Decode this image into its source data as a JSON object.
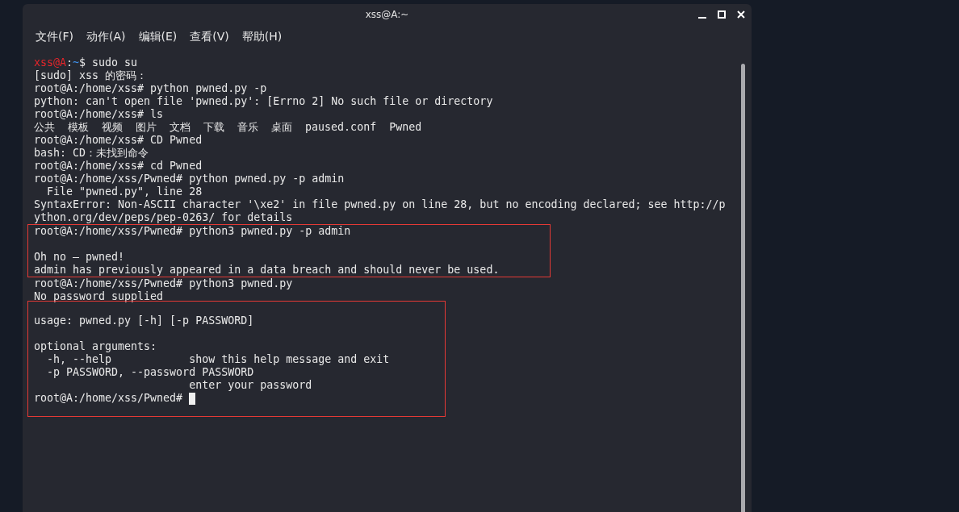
{
  "window": {
    "title": "xss@A:~"
  },
  "menu": [
    "文件(F)",
    "动作(A)",
    "编辑(E)",
    "查看(V)",
    "帮助(H)"
  ],
  "terminal": {
    "blocks": [
      {
        "highlighted": false,
        "lines": [
          {
            "kind": "segments",
            "segments": [
              {
                "text": "xss@A",
                "color": "#e5262b"
              },
              {
                "text": ":"
              },
              {
                "text": "~",
                "color": "#3f8fe8"
              },
              {
                "text": "$ sudo su"
              }
            ]
          },
          {
            "kind": "text",
            "text": "[sudo] xss 的密码："
          },
          {
            "kind": "text",
            "text": "root@A:/home/xss# python pwned.py -p"
          },
          {
            "kind": "text",
            "text": "python: can't open file 'pwned.py': [Errno 2] No such file or directory"
          },
          {
            "kind": "text",
            "text": "root@A:/home/xss# ls"
          },
          {
            "kind": "text",
            "text": "公共  模板  视频  图片  文档  下载  音乐  桌面  paused.conf  Pwned"
          },
          {
            "kind": "text",
            "text": "root@A:/home/xss# CD Pwned"
          },
          {
            "kind": "text",
            "text": "bash: CD：未找到命令"
          },
          {
            "kind": "text",
            "text": "root@A:/home/xss# cd Pwned"
          },
          {
            "kind": "text",
            "text": "root@A:/home/xss/Pwned# python pwned.py -p admin"
          },
          {
            "kind": "text",
            "text": "  File \"pwned.py\", line 28"
          },
          {
            "kind": "text",
            "text": "SyntaxError: Non-ASCII character '\\xe2' in file pwned.py on line 28, but no encoding declared; see http://p"
          },
          {
            "kind": "text",
            "text": "ython.org/dev/peps/pep-0263/ for details"
          }
        ]
      },
      {
        "highlighted": true,
        "lines": [
          {
            "kind": "text",
            "text": "root@A:/home/xss/Pwned# python3 pwned.py -p admin"
          },
          {
            "kind": "blank"
          },
          {
            "kind": "text",
            "text": "Oh no — pwned!"
          },
          {
            "kind": "text",
            "text": "admin has previously appeared in a data breach and should never be used."
          }
        ]
      },
      {
        "highlighted": false,
        "lines": [
          {
            "kind": "text",
            "text": "root@A:/home/xss/Pwned# python3 pwned.py"
          },
          {
            "kind": "text",
            "text": "No password supplied"
          }
        ]
      },
      {
        "highlighted": true,
        "lines": [
          {
            "kind": "blank"
          },
          {
            "kind": "text",
            "text": "usage: pwned.py [-h] [-p PASSWORD]"
          },
          {
            "kind": "blank"
          },
          {
            "kind": "text",
            "text": "optional arguments:"
          },
          {
            "kind": "text",
            "text": "  -h, --help            show this help message and exit"
          },
          {
            "kind": "text",
            "text": "  -p PASSWORD, --password PASSWORD"
          },
          {
            "kind": "text",
            "text": "                        enter your password"
          },
          {
            "kind": "cursor_prompt",
            "text": "root@A:/home/xss/Pwned# "
          }
        ]
      }
    ]
  }
}
